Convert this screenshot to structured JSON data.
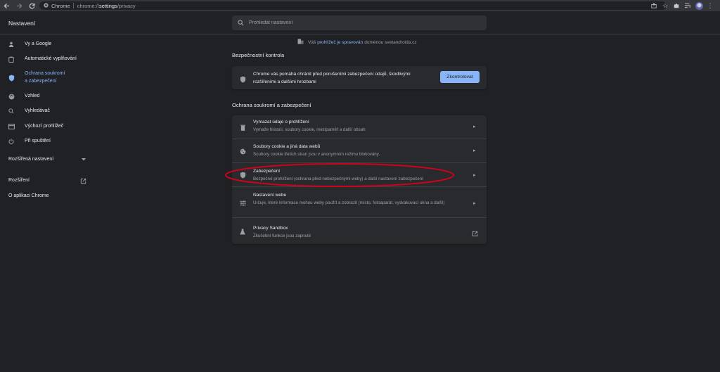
{
  "browser": {
    "site_label": "Chrome",
    "url_scheme": "chrome://",
    "url_host": "settings",
    "url_path": "/privacy"
  },
  "header": {
    "title": "Nastavení",
    "search_placeholder": "Prohledat nastavení"
  },
  "sidebar": {
    "items": [
      {
        "label": "Vy a Google",
        "icon": "person-icon"
      },
      {
        "label": "Automatické vyplňování",
        "icon": "clipboard-icon"
      },
      {
        "label": "Ochrana soukromí",
        "label2": "a zabezpečení",
        "icon": "shield-icon",
        "active": true
      },
      {
        "label": "Vzhled",
        "icon": "palette-icon"
      },
      {
        "label": "Vyhledávač",
        "icon": "search-icon"
      },
      {
        "label": "Výchozí prohlížeč",
        "icon": "browser-icon"
      },
      {
        "label": "Při spuštění",
        "icon": "power-icon"
      }
    ],
    "advanced": "Rozšířená nastavení",
    "extensions": "Rozšíření",
    "about": "O aplikaci Chrome"
  },
  "managed": {
    "prefix": "Váš",
    "link": "prohlížeč je spravován",
    "suffix": "doménou svetandroida.cz"
  },
  "safety_check": {
    "heading": "Bezpečnostní kontrola",
    "text": "Chrome vás pomáhá chránit před porušeními zabezpečení údajů, škodlivými rozšířeními a dalšími hrozbami",
    "button": "Zkontrolovat"
  },
  "privacy": {
    "heading": "Ochrana soukromí a zabezpečení",
    "rows": [
      {
        "title": "Vymazat údaje o prohlížení",
        "sub": "Vymaže historii, soubory cookie, mezipaměť a další obsah",
        "icon": "trash-icon"
      },
      {
        "title": "Soubory cookie a jiná data webů",
        "sub": "Soubory cookie třetích stran jsou v anonymním režimu blokovány.",
        "icon": "cookie-icon"
      },
      {
        "title": "Zabezpečení",
        "sub": "Bezpečné prohlížení (ochrana před nebezpečnými weby) a další nastavení zabezpečení",
        "icon": "shield-icon"
      },
      {
        "title": "Nastavení webu",
        "sub": "Určuje, které informace mohou weby použít a zobrazit (místo, fotoaparát, vyskakovací okna a další)",
        "icon": "sliders-icon"
      },
      {
        "title": "Privacy Sandbox",
        "sub": "Zkušební funkce jsou zapnuté",
        "icon": "flask-icon"
      }
    ]
  },
  "colors": {
    "background": "#202124",
    "card": "#292a2d",
    "accent": "#8ab4f8",
    "highlight_ellipse": "#d0021b"
  }
}
